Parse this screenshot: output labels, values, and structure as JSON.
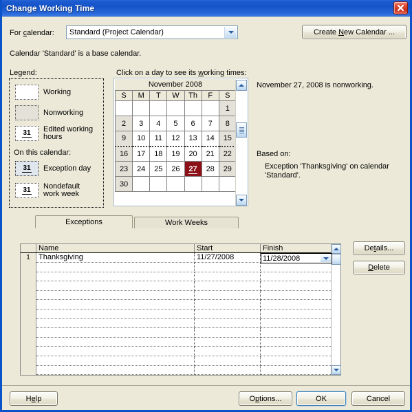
{
  "window": {
    "title": "Change Working Time",
    "close_icon": "close-icon"
  },
  "top": {
    "for_calendar_label_pre": "For ",
    "for_calendar_label_key": "c",
    "for_calendar_label_post": "alendar:",
    "calendar_value": "Standard (Project Calendar)",
    "create_new_pre": "Create ",
    "create_new_key": "N",
    "create_new_post": "ew Calendar ...",
    "base_calendar_note": "Calendar 'Standard' is a base calendar."
  },
  "legend": {
    "heading": "Legend:",
    "items": [
      {
        "swatch": "blank",
        "style": "working",
        "label": "Working"
      },
      {
        "swatch": "blank",
        "style": "nonworking",
        "label": "Nonworking"
      },
      {
        "swatch": "31",
        "style": "edited",
        "label": "Edited working hours"
      }
    ],
    "subheading": "On this calendar:",
    "items2": [
      {
        "swatch": "31",
        "style": "exception",
        "label": "Exception day"
      },
      {
        "swatch": "31",
        "style": "nondefault",
        "label": "Nondefault work week"
      }
    ]
  },
  "calendar": {
    "instruction_pre": "Click on a day to see its ",
    "instruction_key": "w",
    "instruction_post": "orking times:",
    "month_title": "November 2008",
    "weekday_headers": [
      "S",
      "M",
      "T",
      "W",
      "Th",
      "F",
      "S"
    ],
    "weeks": [
      {
        "marked": false,
        "days": [
          {
            "n": "",
            "type": "empty"
          },
          {
            "n": "",
            "type": "empty"
          },
          {
            "n": "",
            "type": "empty"
          },
          {
            "n": "",
            "type": "empty"
          },
          {
            "n": "",
            "type": "empty"
          },
          {
            "n": "",
            "type": "empty"
          },
          {
            "n": "1",
            "type": "nonworking"
          }
        ]
      },
      {
        "marked": false,
        "days": [
          {
            "n": "2",
            "type": "nonworking"
          },
          {
            "n": "3",
            "type": "working"
          },
          {
            "n": "4",
            "type": "working"
          },
          {
            "n": "5",
            "type": "working"
          },
          {
            "n": "6",
            "type": "working"
          },
          {
            "n": "7",
            "type": "working"
          },
          {
            "n": "8",
            "type": "nonworking"
          }
        ]
      },
      {
        "marked": false,
        "days": [
          {
            "n": "9",
            "type": "nonworking"
          },
          {
            "n": "10",
            "type": "working"
          },
          {
            "n": "11",
            "type": "working"
          },
          {
            "n": "12",
            "type": "working"
          },
          {
            "n": "13",
            "type": "working"
          },
          {
            "n": "14",
            "type": "working"
          },
          {
            "n": "15",
            "type": "nonworking"
          }
        ]
      },
      {
        "marked": true,
        "days": [
          {
            "n": "16",
            "type": "nonworking"
          },
          {
            "n": "17",
            "type": "working"
          },
          {
            "n": "18",
            "type": "working"
          },
          {
            "n": "19",
            "type": "working"
          },
          {
            "n": "20",
            "type": "working"
          },
          {
            "n": "21",
            "type": "working"
          },
          {
            "n": "22",
            "type": "nonworking"
          }
        ]
      },
      {
        "marked": false,
        "days": [
          {
            "n": "23",
            "type": "nonworking"
          },
          {
            "n": "24",
            "type": "working"
          },
          {
            "n": "25",
            "type": "working"
          },
          {
            "n": "26",
            "type": "working"
          },
          {
            "n": "27",
            "type": "selected"
          },
          {
            "n": "28",
            "type": "working"
          },
          {
            "n": "29",
            "type": "nonworking"
          }
        ]
      },
      {
        "marked": false,
        "days": [
          {
            "n": "30",
            "type": "nonworking"
          },
          {
            "n": "",
            "type": "empty"
          },
          {
            "n": "",
            "type": "empty"
          },
          {
            "n": "",
            "type": "empty"
          },
          {
            "n": "",
            "type": "empty"
          },
          {
            "n": "",
            "type": "empty"
          },
          {
            "n": "",
            "type": "empty"
          }
        ]
      }
    ],
    "scrollbar": {
      "up_icon": "scroll-up-icon",
      "down_icon": "scroll-down-icon"
    }
  },
  "info": {
    "status_line": "November 27, 2008 is nonworking.",
    "based_on_label": "Based on:",
    "based_on_detail_line1": "Exception 'Thanksgiving' on calendar",
    "based_on_detail_line2": "'Standard'."
  },
  "tabs": [
    {
      "label": "Exceptions",
      "active": true
    },
    {
      "label": "Work Weeks",
      "active": false
    }
  ],
  "grid": {
    "columns": [
      "Name",
      "Start",
      "Finish"
    ],
    "rows": [
      {
        "num": "1",
        "name": "Thanksgiving",
        "start": "11/27/2008",
        "finish": "11/28/2008"
      },
      {
        "num": "",
        "name": "",
        "start": "",
        "finish": ""
      },
      {
        "num": "",
        "name": "",
        "start": "",
        "finish": ""
      },
      {
        "num": "",
        "name": "",
        "start": "",
        "finish": ""
      },
      {
        "num": "",
        "name": "",
        "start": "",
        "finish": ""
      },
      {
        "num": "",
        "name": "",
        "start": "",
        "finish": ""
      },
      {
        "num": "",
        "name": "",
        "start": "",
        "finish": ""
      },
      {
        "num": "",
        "name": "",
        "start": "",
        "finish": ""
      },
      {
        "num": "",
        "name": "",
        "start": "",
        "finish": ""
      },
      {
        "num": "",
        "name": "",
        "start": "",
        "finish": ""
      },
      {
        "num": "",
        "name": "",
        "start": "",
        "finish": ""
      },
      {
        "num": "",
        "name": "",
        "start": "",
        "finish": ""
      },
      {
        "num": "",
        "name": "",
        "start": "",
        "finish": ""
      }
    ],
    "editing_cell_value": "11/28/2008",
    "editing_cell_row": 0,
    "editing_cell_column": "Finish"
  },
  "side_buttons": {
    "details_pre": "De",
    "details_key": "t",
    "details_post": "ails...",
    "delete_pre": "",
    "delete_key": "D",
    "delete_post": "elete"
  },
  "footer": {
    "help_pre": "H",
    "help_key": "e",
    "help_post": "lp",
    "options_pre": "O",
    "options_key": "p",
    "options_post": "tions...",
    "ok": "OK",
    "cancel": "Cancel"
  }
}
